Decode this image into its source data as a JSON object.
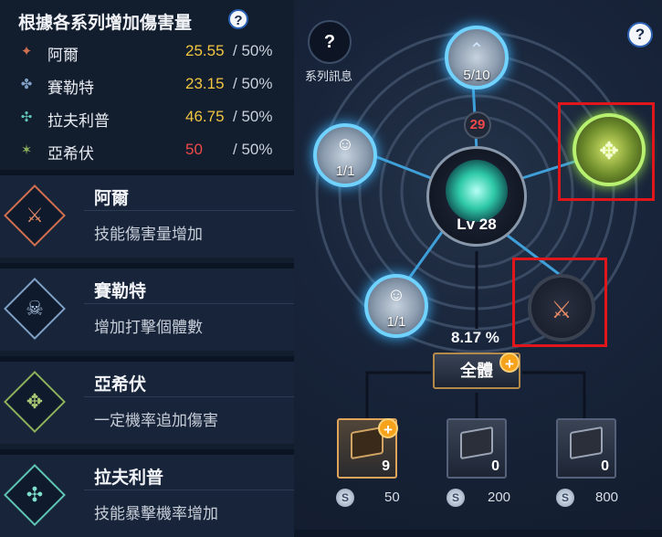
{
  "stats": {
    "title": "根據各系列增加傷害量",
    "help": "?",
    "rows": [
      {
        "name": "阿爾",
        "value": "25.55",
        "max": "/ 50%",
        "icon": "✦",
        "color": "#d07050"
      },
      {
        "name": "賽勒特",
        "value": "23.15",
        "max": "/ 50%",
        "icon": "✤",
        "color": "#7fa0c4"
      },
      {
        "name": "拉夫利普",
        "value": "46.75",
        "max": "/ 50%",
        "icon": "✣",
        "color": "#5fc4b2"
      },
      {
        "name": "亞希伏",
        "value": "50",
        "max": "/ 50%",
        "icon": "✶",
        "color": "#8cb05a"
      }
    ]
  },
  "skills": [
    {
      "name": "阿爾",
      "desc": "技能傷害量增加",
      "icon": "⚔"
    },
    {
      "name": "賽勒特",
      "desc": "增加打擊個體數",
      "icon": "☠"
    },
    {
      "name": "亞希伏",
      "desc": "一定機率追加傷害",
      "icon": "✥"
    },
    {
      "name": "拉夫利普",
      "desc": "技能暴擊機率增加",
      "icon": "✣"
    }
  ],
  "tree": {
    "series_btn": "?",
    "series_label": "系列訊息",
    "corner_help": "?",
    "top_node": "5/10",
    "left_top_node": "1/1",
    "left_bottom_node": "1/1",
    "center_level": "Lv 28",
    "count": "29",
    "percent": "8.17 %",
    "all_button": "全體",
    "plus": "+",
    "items": [
      {
        "count": "9",
        "cost": "50"
      },
      {
        "count": "0",
        "cost": "200"
      },
      {
        "count": "0",
        "cost": "800"
      }
    ],
    "coin": "S"
  },
  "colors": {
    "gold": "#f1c640",
    "red": "#ee4a4a",
    "highlight": "#e0161a",
    "accent_orange": "#f6a21a"
  }
}
